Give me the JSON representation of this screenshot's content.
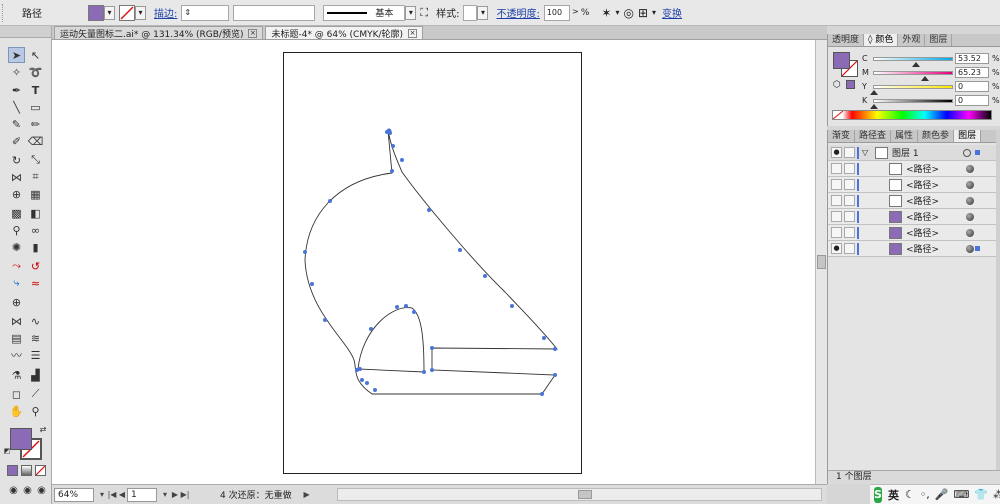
{
  "control_bar": {
    "selection_label": "路径",
    "fill_color": "#8b6bb5",
    "stroke_label": "描边:",
    "stroke_profile_label": "基本",
    "style_label": "样式:",
    "opacity_label": "不透明度:",
    "opacity_value": "100",
    "opacity_unit": "%",
    "transform_label": "变换"
  },
  "document_tabs": [
    {
      "label": "运动矢量图标二.ai* @ 131.34% (RGB/预览)",
      "active": false
    },
    {
      "label": "未标题-4* @ 64% (CMYK/轮廓)",
      "active": true
    }
  ],
  "toolbox": {
    "fill_color": "#8b6bb5",
    "stroke_color": "none"
  },
  "status_bar": {
    "zoom": "64%",
    "artboard_number": "1",
    "history_text": "4 次还原：无重做"
  },
  "color_panel": {
    "tabs": [
      "透明度",
      "颜色",
      "外观",
      "图层"
    ],
    "active_tab": "颜色",
    "sliders": [
      {
        "label": "C",
        "value": "53.52",
        "unit": "%",
        "color_from": "#ffffff",
        "color_to": "#00a8e6"
      },
      {
        "label": "M",
        "value": "65.23",
        "unit": "%",
        "color_from": "#ffffff",
        "color_to": "#e6007e"
      },
      {
        "label": "Y",
        "value": "0",
        "unit": "%",
        "color_from": "#ffffff",
        "color_to": "#ffe600"
      },
      {
        "label": "K",
        "value": "0",
        "unit": "%",
        "color_from": "#ffffff",
        "color_to": "#000000"
      }
    ],
    "current_color": "#8b6bb5"
  },
  "layers_panel": {
    "tabs": [
      "渐变",
      "路径查",
      "属性",
      "颜色参",
      "图层"
    ],
    "active_tab": "图层",
    "layer_name": "图层 1",
    "items": [
      {
        "label": "<路径>"
      },
      {
        "label": "<路径>"
      },
      {
        "label": "<路径>"
      },
      {
        "label": "<路径>"
      },
      {
        "label": "<路径>"
      },
      {
        "label": "<路径>"
      }
    ],
    "footer_text": "1 个图层"
  },
  "tray": {
    "ime_label": "英",
    "ime_logo": "S"
  }
}
